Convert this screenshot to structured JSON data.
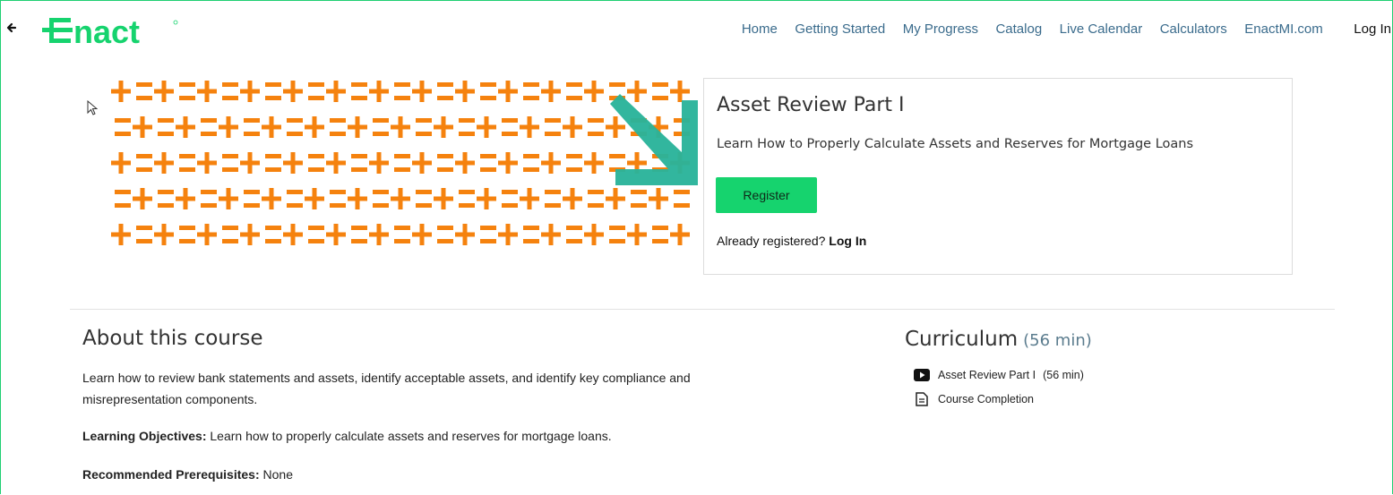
{
  "header": {
    "logo_text": "Enact",
    "nav": [
      "Home",
      "Getting Started",
      "My Progress",
      "Catalog",
      "Live Calendar",
      "Calculators",
      "EnactMI.com"
    ],
    "login": "Log In"
  },
  "course": {
    "title": "Asset Review Part I",
    "subtitle": "Learn How to Properly Calculate Assets and Reserves for Mortgage Loans",
    "register_label": "Register",
    "already_text": "Already registered?",
    "already_link": "Log In"
  },
  "about": {
    "title": "About this course",
    "description": "Learn how to review bank statements and assets, identify acceptable assets, and identify key compliance and misrepresentation components.",
    "objectives_label": "Learning Objectives:",
    "objectives_text": "Learn how to properly calculate assets and reserves for mortgage loans.",
    "prereq_label": "Recommended Prerequisites:",
    "prereq_text": "None"
  },
  "curriculum": {
    "title": "Curriculum",
    "duration": "(56 min)",
    "items": [
      {
        "label": "Asset Review Part I",
        "duration": "(56 min)",
        "icon": "video-icon"
      },
      {
        "label": "Course Completion",
        "icon": "document-icon"
      }
    ]
  },
  "colors": {
    "brand_green": "#16d36e",
    "banner_orange": "#f5820e",
    "annotation_teal": "#2ab39a",
    "nav_link": "#3a6b8c"
  }
}
